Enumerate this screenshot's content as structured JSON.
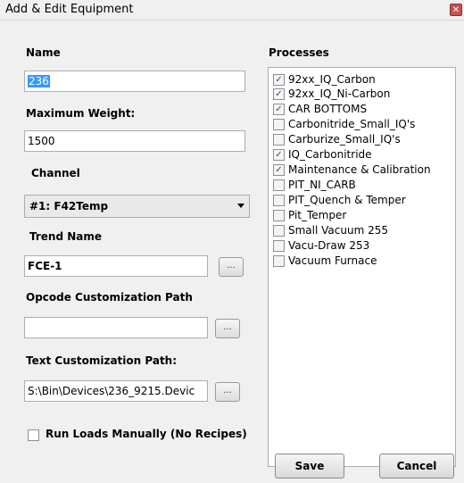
{
  "window": {
    "title": "Add & Edit Equipment",
    "close_glyph": "✕"
  },
  "form": {
    "name_label": "Name",
    "name_value": "236",
    "max_weight_label": "Maximum Weight:",
    "max_weight_value": "1500",
    "channel_label": "Channel",
    "channel_value": "#1: F42Temp",
    "trend_label": "Trend Name",
    "trend_value": "FCE-1",
    "opcode_label": "Opcode Customization Path",
    "opcode_value": "",
    "text_path_label": "Text Customization Path:",
    "text_path_value": "S:\\Bin\\Devices\\236_9215.Devic",
    "browse_label": "...",
    "run_manual_label": "Run Loads Manually (No Recipes)",
    "run_manual_checked": false
  },
  "processes": {
    "label": "Processes",
    "items": [
      {
        "label": "92xx_IQ_Carbon",
        "checked": true
      },
      {
        "label": "92xx_IQ_Ni-Carbon",
        "checked": true
      },
      {
        "label": "CAR BOTTOMS",
        "checked": true
      },
      {
        "label": "Carbonitride_Small_IQ's",
        "checked": false
      },
      {
        "label": "Carburize_Small_IQ's",
        "checked": false
      },
      {
        "label": "IQ_Carbonitride",
        "checked": true
      },
      {
        "label": "Maintenance & Calibration",
        "checked": true
      },
      {
        "label": "PIT_NI_CARB",
        "checked": false
      },
      {
        "label": "PIT_Quench & Temper",
        "checked": false
      },
      {
        "label": "Pit_Temper",
        "checked": false
      },
      {
        "label": "Small Vacuum 255",
        "checked": false
      },
      {
        "label": "Vacu-Draw 253",
        "checked": false
      },
      {
        "label": "Vacuum Furnace",
        "checked": false
      }
    ],
    "check_glyph": "✓"
  },
  "buttons": {
    "save": "Save",
    "cancel": "Cancel"
  }
}
